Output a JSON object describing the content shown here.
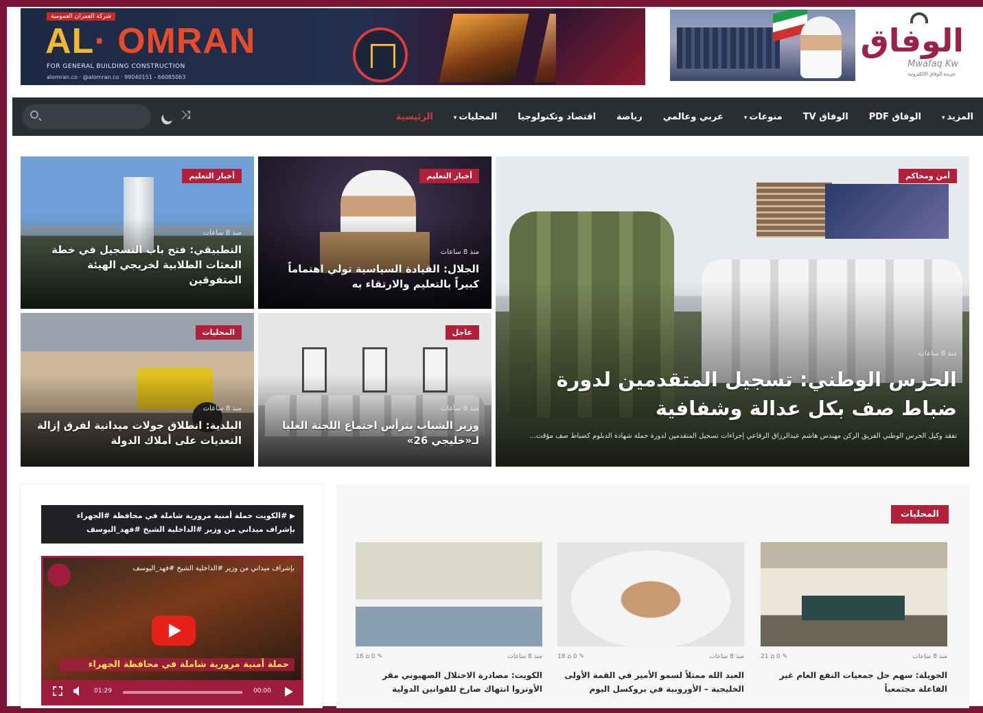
{
  "ad_banner": {
    "tag": "شركة العمران العمومية",
    "brand_prefix": "AL",
    "brand_name": "OMRAN",
    "subtitle": "FOR GENERAL BUILDING CONSTRUCTION",
    "contact": "alomran.co  ·  @alomran.co  ·  99040151 - 66085063"
  },
  "site_logo": {
    "arabic": "الوفاق",
    "latin": "Mwafaq Kw",
    "tagline": "جريدة الوفاق الإلكترونية"
  },
  "nav": {
    "items": [
      {
        "label": "الرئيسية",
        "active": true,
        "caret": false
      },
      {
        "label": "المحليات",
        "active": false,
        "caret": true
      },
      {
        "label": "اقتصاد وتكنولوجيا",
        "active": false,
        "caret": false
      },
      {
        "label": "رياضة",
        "active": false,
        "caret": false
      },
      {
        "label": "عربي وعالمي",
        "active": false,
        "caret": false
      },
      {
        "label": "منوعات",
        "active": false,
        "caret": true
      },
      {
        "label": "الوفاق TV",
        "active": false,
        "caret": false
      },
      {
        "label": "الوفاق PDF",
        "active": false,
        "caret": false
      },
      {
        "label": "المزيد",
        "active": false,
        "caret": true
      }
    ],
    "search_placeholder": "",
    "caret_glyph": "▾"
  },
  "hero": {
    "main": {
      "category": "أمن ومحاكم",
      "time": "منذ 8 ساعات",
      "title": "الحرس الوطني: تسجيل المتقدمين لدورة ضباط صف بكل عدالة وشفافية",
      "excerpt": "تفقد وكيل الحرس الوطني الفريق الركن مهندس هاشم عبدالرزاق الرفاعي إجراءات تسجيل المتقدمين لدورة حملة شهادة الدبلوم كضباط صف مؤقت..."
    },
    "top_middle": {
      "category": "أخبار التعليم",
      "time": "منذ 8 ساعات",
      "title": "الجلال: القيادة السياسية تولي اهتماماً كبيراً بالتعليم والارتقاء به"
    },
    "top_left": {
      "category": "أخبار التعليم",
      "time": "منذ 8 ساعات",
      "title": "التطبيقي: فتح باب التسجيل في خطة البعثات الطلابية لخريجي الهيئة المتفوقين"
    },
    "bottom_middle": {
      "category": "عاجل",
      "time": "منذ 8 ساعات",
      "title": "وزير الشباب يترأس اجتماع اللجنة العليا لـ«خليجي 26»"
    },
    "bottom_left": {
      "category": "المحليات",
      "time": "منذ 8 ساعات",
      "title": "البلدية: انطلاق جولات ميدانية لفرق إزالة التعديات على أملاك الدولة"
    }
  },
  "video": {
    "caption": "#الكويت حملة أمنية مرورية شاملة في محافظة #الجهراء بإشراف ميداني من وزير #الداخلية الشيخ #فهد_اليوسف",
    "caption_icon": "▶",
    "overlay_title": "بإشراف ميداني من وزير #الداخلية الشيخ #فهد_اليوسف",
    "headline": "حملة أمنية مرورية شاملة في محافظة الجهراء",
    "time_elapsed": "00:00",
    "time_total": "01:29"
  },
  "local_section": {
    "title": "المحليات",
    "cards": [
      {
        "date": "منذ 8 ساعات",
        "stats": "21 ⌂  0 ✎",
        "headline": "الحويلة: سهم حل جمعيات النفع العام غير الفاعلة مجتمعياً"
      },
      {
        "date": "منذ 8 ساعات",
        "stats": "18 ⌂  0 ✎",
        "headline": "العبد الله ممثلاً لسمو الأمير في القمة الأولى الخليجية – الأوروبية في بروكسل اليوم"
      },
      {
        "date": "منذ 8 ساعات",
        "stats": "16 ⌂  0 ✎",
        "headline": "الكويت: مصادرة الاحتلال الصهيوني مقر الأونروا انتهاك صارخ للقوانين الدولية"
      }
    ]
  }
}
